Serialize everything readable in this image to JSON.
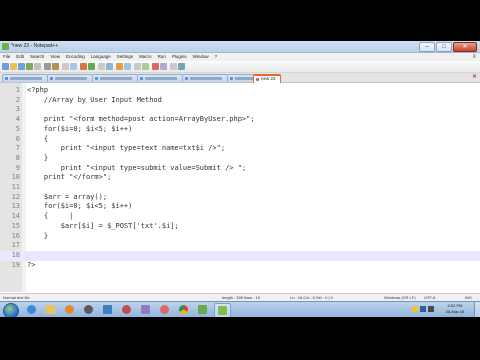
{
  "window": {
    "title": "*new 23 - Notepad++"
  },
  "menu": [
    "File",
    "Edit",
    "Search",
    "View",
    "Encoding",
    "Language",
    "Settings",
    "Macro",
    "Run",
    "Plugins",
    "Window",
    "?"
  ],
  "menu_close": "X",
  "tabs": {
    "active_label": "new 23"
  },
  "editor": {
    "current_line": 18,
    "lines": [
      {
        "n": "1",
        "text": "<?php"
      },
      {
        "n": "2",
        "text": "    //Array by User Input Method"
      },
      {
        "n": "3",
        "text": ""
      },
      {
        "n": "4",
        "text": "    print \"<form method=post action=ArrayByUser.php>\";"
      },
      {
        "n": "5",
        "text": "    for($i=0; $i<5; $i++)"
      },
      {
        "n": "6",
        "text": "    {"
      },
      {
        "n": "7",
        "text": "        print \"<input type=text name=txt$i />\";"
      },
      {
        "n": "8",
        "text": "    }"
      },
      {
        "n": "9",
        "text": "        print \"<input type=submit value=Submit /> \";"
      },
      {
        "n": "10",
        "text": "    print \"</form>\";"
      },
      {
        "n": "11",
        "text": ""
      },
      {
        "n": "12",
        "text": "    $arr = array();"
      },
      {
        "n": "13",
        "text": "    for($i=0; $i<5; $i++)"
      },
      {
        "n": "14",
        "text": "    {     |"
      },
      {
        "n": "15",
        "text": "        $arr[$i] = $_POST['txt'.$i];"
      },
      {
        "n": "16",
        "text": "    }"
      },
      {
        "n": "17",
        "text": ""
      },
      {
        "n": "18",
        "text": ""
      },
      {
        "n": "19",
        "text": "?>"
      }
    ]
  },
  "status": {
    "file_type": "Normal text file",
    "length": "length : 328    lines : 19",
    "position": "Ln : 18    Col : 5    Sel : 0 | 0",
    "eol": "Windows (CR LF)",
    "encoding": "UTF-8",
    "mode": "INS"
  },
  "clock": {
    "time": "4:52 PM",
    "date": "26-Mar-16"
  },
  "colors": {
    "current_line": "#e8e8ff",
    "active_tab_accent": "#e06b2c"
  }
}
